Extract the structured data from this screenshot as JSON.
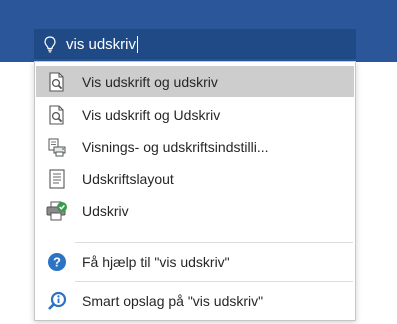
{
  "search": {
    "icon": "lightbulb-icon",
    "value": "vis udskriv"
  },
  "results": [
    {
      "label": "Vis udskrift og udskriv",
      "icon": "print-preview-icon",
      "active": true
    },
    {
      "label": "Vis udskrift og Udskriv",
      "icon": "print-preview-icon",
      "active": false
    },
    {
      "label": "Visnings- og udskriftsindstilli...",
      "icon": "print-settings-icon",
      "active": false
    },
    {
      "label": "Udskriftslayout",
      "icon": "print-layout-icon",
      "active": false
    },
    {
      "label": "Udskriv",
      "icon": "printer-check-icon",
      "active": false
    }
  ],
  "help": {
    "label": "Få hjælp til \"vis udskriv\"",
    "icon": "help-icon"
  },
  "smart_lookup": {
    "label": "Smart opslag på \"vis udskriv\"",
    "icon": "smart-lookup-icon"
  },
  "colors": {
    "ribbon": "#2b579a",
    "search_box": "#1f4a86",
    "highlight": "#cdcdcd",
    "help_blue": "#2b73c4"
  }
}
